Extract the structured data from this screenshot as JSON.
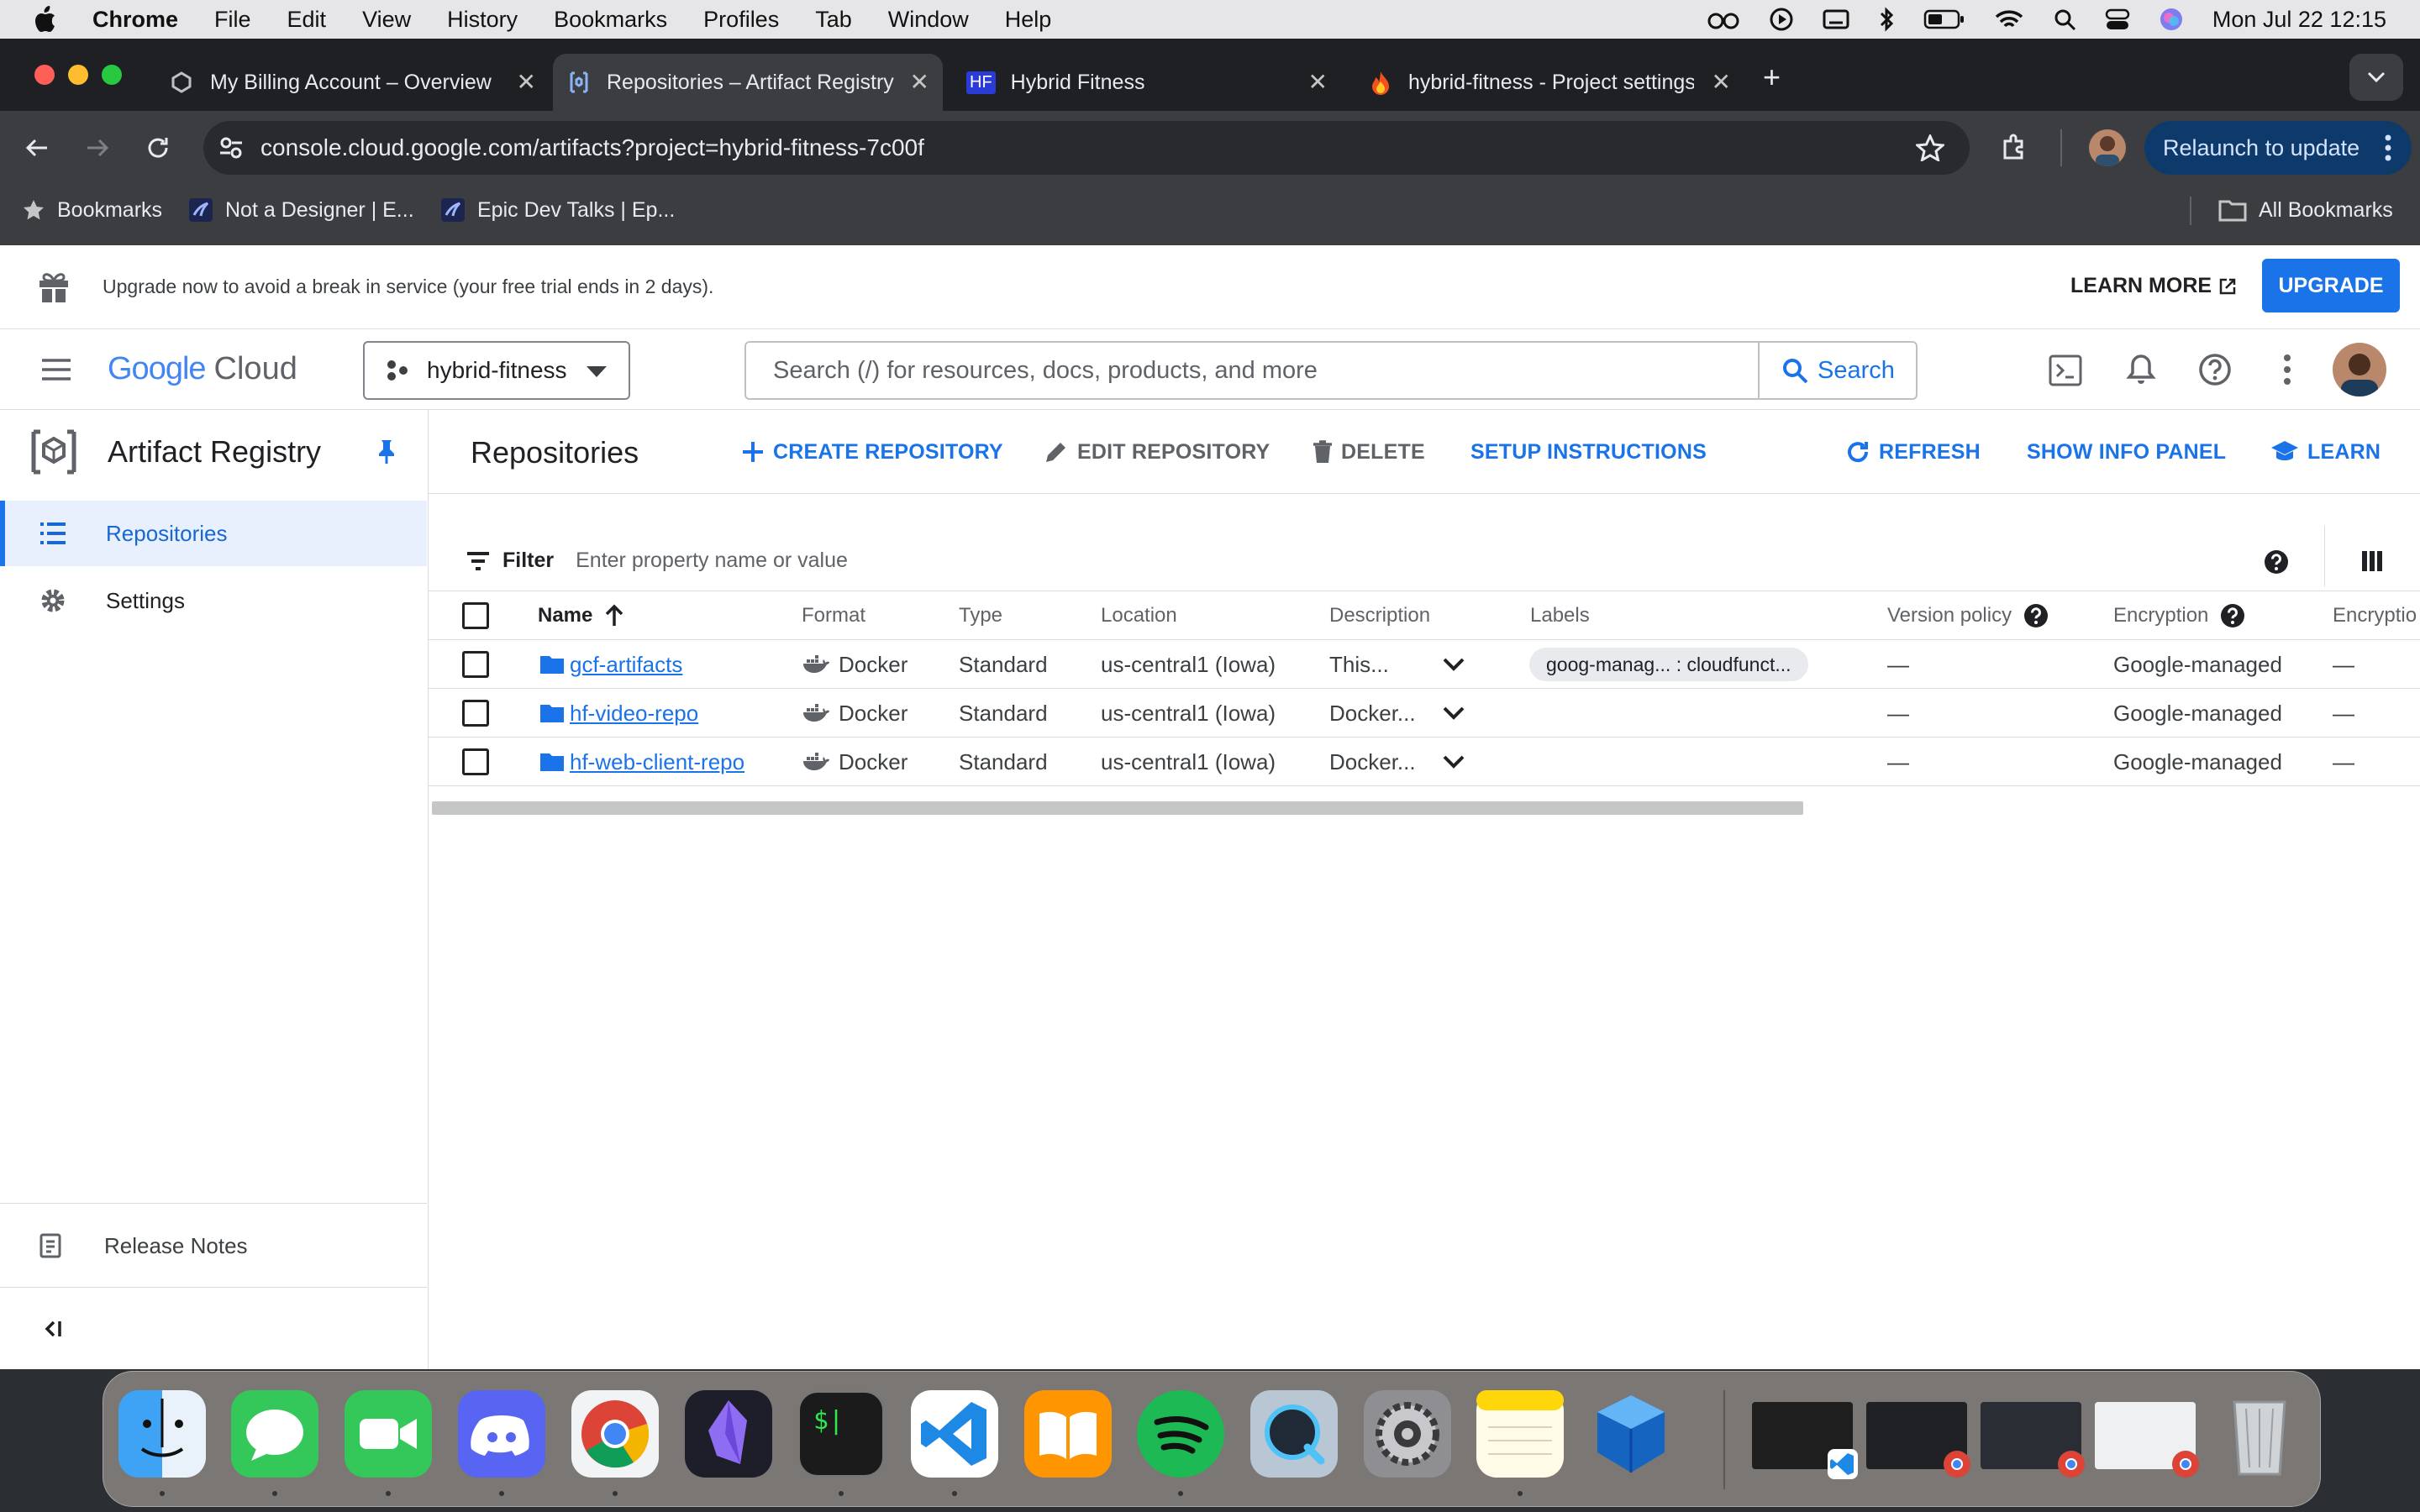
{
  "menubar": {
    "app": "Chrome",
    "items": [
      "File",
      "Edit",
      "View",
      "History",
      "Bookmarks",
      "Profiles",
      "Tab",
      "Window",
      "Help"
    ],
    "clock": "Mon Jul 22  12:15"
  },
  "tabs": [
    {
      "title": "My Billing Account – Overview"
    },
    {
      "title": "Repositories – Artifact Registry"
    },
    {
      "title": "Hybrid Fitness",
      "favicon_text": "HF"
    },
    {
      "title": "hybrid-fitness - Project settings"
    }
  ],
  "toolbar": {
    "url": "console.cloud.google.com/artifacts?project=hybrid-fitness-7c00f",
    "relaunch": "Relaunch to update"
  },
  "bookmarks_bar": {
    "bookmarks_label": "Bookmarks",
    "items": [
      "Not a Designer | E...",
      "Epic Dev Talks | Ep..."
    ],
    "all_bookmarks": "All Bookmarks"
  },
  "banner": {
    "text": "Upgrade now to avoid a break in service (your free trial ends in 2 days).",
    "learn_more": "LEARN MORE",
    "upgrade": "UPGRADE"
  },
  "header": {
    "logo_google": "Google",
    "logo_cloud": "Cloud",
    "project": "hybrid-fitness",
    "search_placeholder": "Search (/) for resources, docs, products, and more",
    "search_button": "Search"
  },
  "sidebar": {
    "product": "Artifact Registry",
    "items": [
      {
        "label": "Repositories"
      },
      {
        "label": "Settings"
      }
    ],
    "release_notes": "Release Notes"
  },
  "actions": {
    "page_title": "Repositories",
    "create": "CREATE REPOSITORY",
    "edit": "EDIT REPOSITORY",
    "delete": "DELETE",
    "setup": "SETUP INSTRUCTIONS",
    "refresh": "REFRESH",
    "info_panel": "SHOW INFO PANEL",
    "learn": "LEARN"
  },
  "filter": {
    "label": "Filter",
    "placeholder": "Enter property name or value"
  },
  "table": {
    "columns": [
      "Name",
      "Format",
      "Type",
      "Location",
      "Description",
      "Labels",
      "Version policy",
      "Encryption",
      "Encryptio"
    ],
    "rows": [
      {
        "name": "gcf-artifacts",
        "format": "Docker",
        "type": "Standard",
        "location": "us-central1 (Iowa)",
        "description": "This...",
        "labels": "goog-manag... : cloudfunct...",
        "version_policy": "—",
        "encryption": "Google-managed",
        "encryption_key": "—"
      },
      {
        "name": "hf-video-repo",
        "format": "Docker",
        "type": "Standard",
        "location": "us-central1 (Iowa)",
        "description": "Docker...",
        "labels": "",
        "version_policy": "—",
        "encryption": "Google-managed",
        "encryption_key": "—"
      },
      {
        "name": "hf-web-client-repo",
        "format": "Docker",
        "type": "Standard",
        "location": "us-central1 (Iowa)",
        "description": "Docker...",
        "labels": "",
        "version_policy": "—",
        "encryption": "Google-managed",
        "encryption_key": "—"
      }
    ]
  },
  "dock": {
    "apps": [
      "finder-icon",
      "messages-icon",
      "facetime-icon",
      "discord-icon",
      "chrome-icon",
      "obsidian-icon",
      "terminal-icon",
      "vscode-icon",
      "books-icon",
      "spotify-icon",
      "quicktime-icon",
      "system-settings-icon",
      "notes-icon",
      "virtualbox-icon"
    ],
    "terminal_glyph": "$|"
  },
  "colors": {
    "accent": "#1a73e8",
    "selected_bg": "#e8f0fe",
    "folder": "#1a73e8"
  }
}
